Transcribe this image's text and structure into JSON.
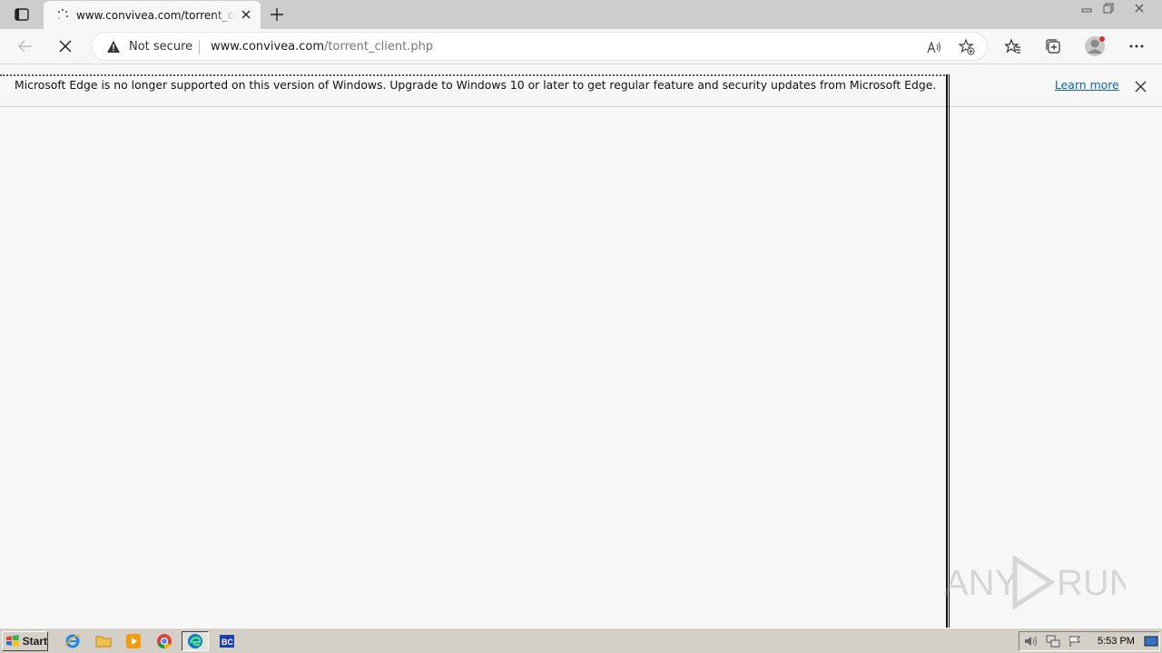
{
  "browser": {
    "tab": {
      "title": "www.convivea.com/torrent_client.php"
    },
    "address_bar": {
      "security_label": "Not secure",
      "url_host": "www.convivea.com",
      "url_path": "/torrent_client.php"
    }
  },
  "infobar": {
    "message": "Microsoft Edge is no longer supported on this version of Windows. Upgrade to Windows 10 or later to get regular feature and security updates from Microsoft Edge.",
    "link": "Learn more"
  },
  "watermark": {
    "text": "ANY RUN"
  },
  "taskbar": {
    "start_label": "Start",
    "clock": "5:53 PM",
    "quick_launch": [
      "internet-explorer-icon",
      "folder-icon",
      "media-player-icon",
      "chrome-icon",
      "edge-icon",
      "app-bc-icon"
    ]
  },
  "colors": {
    "accent_link": "#0b63c4",
    "warning": "#333333",
    "avatar_dot": "#d13438"
  }
}
